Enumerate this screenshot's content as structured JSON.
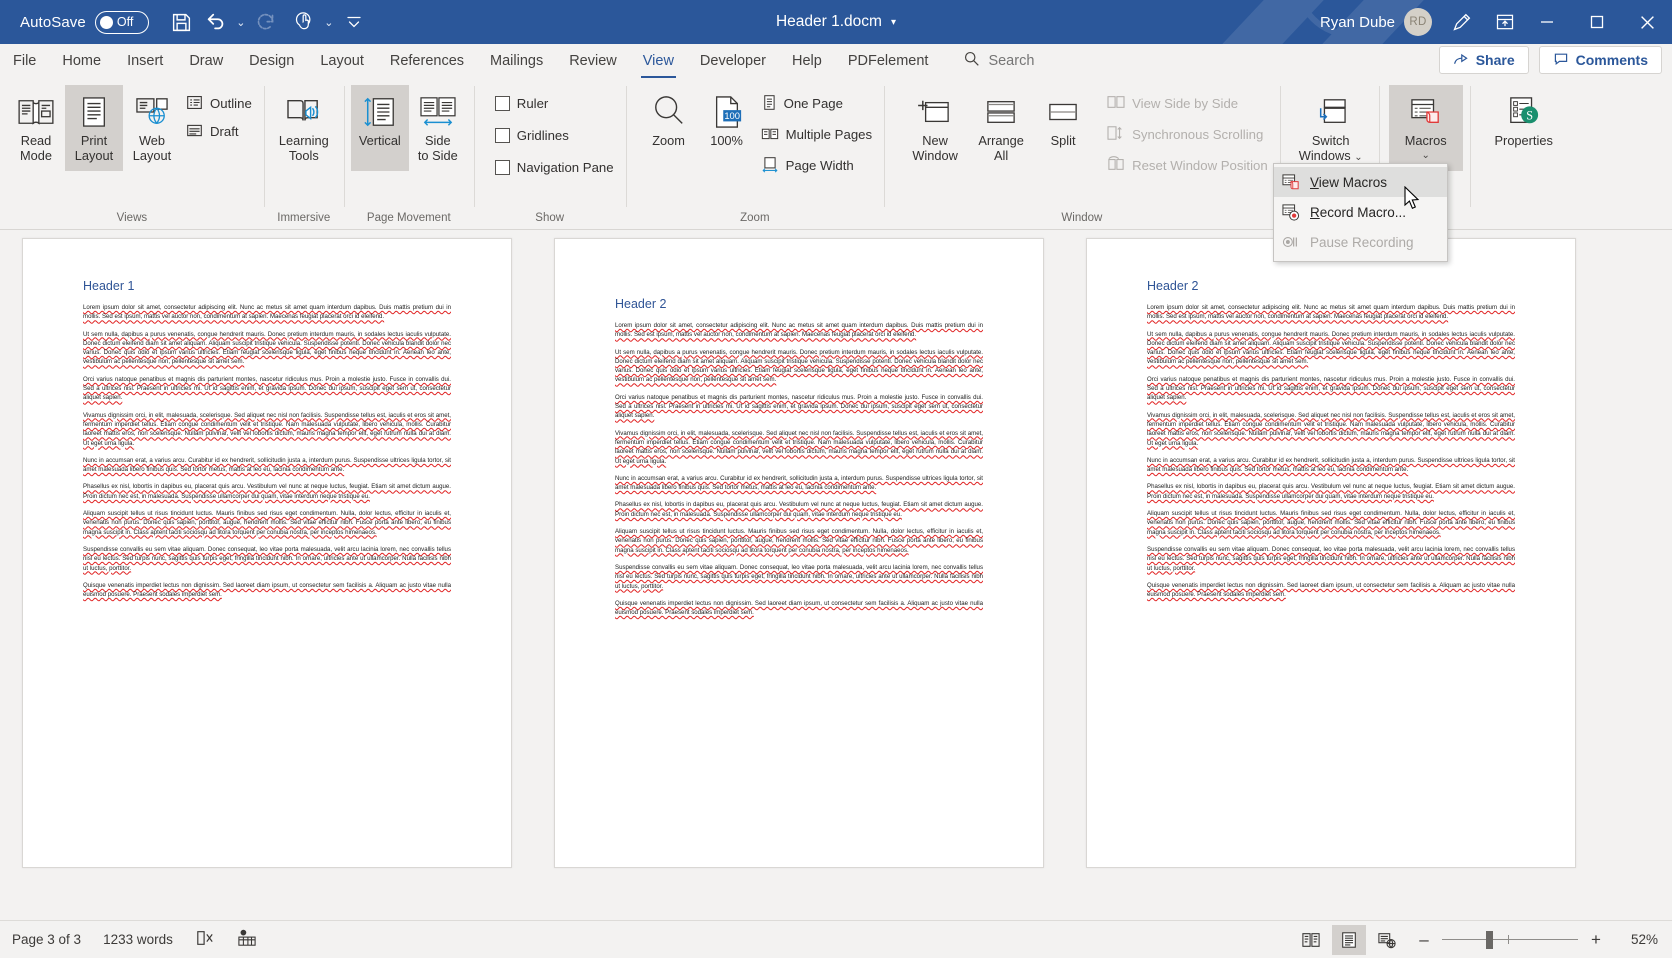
{
  "titlebar": {
    "autosave_label": "AutoSave",
    "autosave_state": "Off",
    "save_icon": "save-icon",
    "undo_icon": "undo-icon",
    "redo_icon": "redo-icon",
    "touch_icon": "touch-mode-icon",
    "customize_icon": "customize-quick-access-icon",
    "document_title": "Header 1.docm",
    "title_caret": "▾",
    "user_name": "Ryan Dube",
    "user_initials": "RD",
    "ink_icon": "pen-ink-icon",
    "ribbon_display_icon": "ribbon-display-options-icon",
    "minimize": "—",
    "maximize": "☐",
    "close": "✕",
    "accent_color": "#2b579a"
  },
  "tabs": [
    {
      "label": "File",
      "active": false
    },
    {
      "label": "Home",
      "active": false
    },
    {
      "label": "Insert",
      "active": false
    },
    {
      "label": "Draw",
      "active": false
    },
    {
      "label": "Design",
      "active": false
    },
    {
      "label": "Layout",
      "active": false
    },
    {
      "label": "References",
      "active": false
    },
    {
      "label": "Mailings",
      "active": false
    },
    {
      "label": "Review",
      "active": false
    },
    {
      "label": "View",
      "active": true
    },
    {
      "label": "Developer",
      "active": false
    },
    {
      "label": "Help",
      "active": false
    },
    {
      "label": "PDFelement",
      "active": false
    }
  ],
  "search": {
    "placeholder": "Search",
    "value": "",
    "icon": "search-icon"
  },
  "share": {
    "label": "Share",
    "icon": "share-icon"
  },
  "comments": {
    "label": "Comments",
    "icon": "comment-icon"
  },
  "ribbon": {
    "groups": [
      {
        "name": "views",
        "label": "Views",
        "big_buttons": [
          {
            "name": "read-mode",
            "line1": "Read",
            "line2": "Mode",
            "icon": "read-mode-icon",
            "selected": false
          },
          {
            "name": "print-layout",
            "line1": "Print",
            "line2": "Layout",
            "icon": "print-layout-icon",
            "selected": true
          },
          {
            "name": "web-layout",
            "line1": "Web",
            "line2": "Layout",
            "icon": "web-layout-icon",
            "selected": false
          }
        ],
        "small_buttons": [
          {
            "name": "outline",
            "label": "Outline",
            "icon": "outline-icon",
            "disabled": false
          },
          {
            "name": "draft",
            "label": "Draft",
            "icon": "draft-icon",
            "disabled": false
          }
        ]
      },
      {
        "name": "immersive",
        "label": "Immersive",
        "big_buttons": [
          {
            "name": "learning-tools",
            "line1": "Learning",
            "line2": "Tools",
            "icon": "learning-tools-icon",
            "selected": false
          }
        ],
        "small_buttons": []
      },
      {
        "name": "page-movement",
        "label": "Page Movement",
        "big_buttons": [
          {
            "name": "vertical",
            "line1": "Vertical",
            "line2": "",
            "icon": "vertical-scroll-icon",
            "selected": true
          },
          {
            "name": "side-to-side",
            "line1": "Side",
            "line2": "to Side",
            "icon": "side-to-side-icon",
            "selected": false
          }
        ],
        "small_buttons": []
      },
      {
        "name": "show",
        "label": "Show",
        "big_buttons": [],
        "small_buttons": [
          {
            "name": "ruler",
            "label": "Ruler",
            "icon": "checkbox-icon",
            "checked": false
          },
          {
            "name": "gridlines",
            "label": "Gridlines",
            "icon": "checkbox-icon",
            "checked": false
          },
          {
            "name": "navigation-pane",
            "label": "Navigation Pane",
            "icon": "checkbox-icon",
            "checked": false
          }
        ]
      },
      {
        "name": "zoom",
        "label": "Zoom",
        "big_buttons": [
          {
            "name": "zoom",
            "line1": "Zoom",
            "line2": "",
            "icon": "magnifier-icon",
            "selected": false
          },
          {
            "name": "zoom-100",
            "line1": "100%",
            "line2": "",
            "icon": "zoom-100-icon",
            "selected": false
          }
        ],
        "small_buttons": [
          {
            "name": "one-page",
            "label": "One Page",
            "icon": "one-page-icon",
            "disabled": false
          },
          {
            "name": "multiple-pages",
            "label": "Multiple Pages",
            "icon": "multiple-pages-icon",
            "disabled": false
          },
          {
            "name": "page-width",
            "label": "Page Width",
            "icon": "page-width-icon",
            "disabled": false
          }
        ]
      },
      {
        "name": "window",
        "label": "Window",
        "big_buttons": [
          {
            "name": "new-window",
            "line1": "New",
            "line2": "Window",
            "icon": "new-window-icon",
            "selected": false
          },
          {
            "name": "arrange-all",
            "line1": "Arrange",
            "line2": "All",
            "icon": "arrange-all-icon",
            "selected": false
          },
          {
            "name": "split",
            "line1": "Split",
            "line2": "",
            "icon": "split-icon",
            "selected": false
          }
        ],
        "small_buttons": [
          {
            "name": "view-side-by-side",
            "label": "View Side by Side",
            "icon": "side-by-side-icon",
            "disabled": true
          },
          {
            "name": "synchronous-scrolling",
            "label": "Synchronous Scrolling",
            "icon": "sync-scroll-icon",
            "disabled": true
          },
          {
            "name": "reset-window-position",
            "label": "Reset Window Position",
            "icon": "reset-window-icon",
            "disabled": true
          }
        ]
      },
      {
        "name": "switch-windows-group",
        "label": "",
        "big_buttons": [
          {
            "name": "switch-windows",
            "line1": "Switch",
            "line2": "Windows",
            "icon": "switch-windows-icon",
            "selected": false,
            "caret": "⌄"
          }
        ],
        "small_buttons": []
      },
      {
        "name": "macros-group",
        "label": "",
        "big_buttons": [
          {
            "name": "macros",
            "line1": "Macros",
            "line2": "",
            "icon": "macros-icon",
            "selected": true,
            "caret": "⌄"
          }
        ],
        "small_buttons": []
      },
      {
        "name": "properties-group",
        "label": "",
        "big_buttons": [
          {
            "name": "properties",
            "line1": "Properties",
            "line2": "",
            "icon": "sharepoint-properties-icon",
            "selected": false
          }
        ],
        "small_buttons": []
      }
    ]
  },
  "macros_menu": {
    "items": [
      {
        "name": "view-macros",
        "mnemonic": "V",
        "rest": "iew Macros",
        "icon": "view-macros-icon",
        "hover": true,
        "disabled": false
      },
      {
        "name": "record-macro",
        "mnemonic": "R",
        "rest": "ecord Macro...",
        "icon": "record-macro-icon",
        "hover": false,
        "disabled": false
      },
      {
        "name": "pause-recording",
        "mnemonic": "",
        "rest": "Pause Recording",
        "icon": "pause-recording-icon",
        "hover": false,
        "disabled": true
      }
    ]
  },
  "document": {
    "pages": [
      {
        "name": "page-1",
        "heading": "Header 1",
        "shifted": false,
        "paragraphs": [
          "Lorem ipsum dolor sit amet, consectetur adipiscing elit. Nunc ac metus sit amet quam interdum dapibus. Duis mattis pretium dui in mollis. Sed est ipsum, mattis vel auctor non, condimentum at sapien. Maecenas feugiat placerat orci id eleifend.",
          "Ut sem nulla, dapibus a purus venenatis, congue hendrerit mauris. Donec pretium interdum mauris, in sodales lectus iaculis vulputate. Donec dictum eleifend diam sit amet aliquam. Aliquam suscipit tristique vehicula. Suspendisse potenti. Donec vehicula blandit dolor nec varius. Donec quis odio et ipsum varius ultricies. Etiam feugiat scelerisque ligula, eget finibus neque tincidunt in. Aenean leo ante, vestibulum ac pellentesque non, pellentesque sit amet sem.",
          "Orci varius natoque penatibus et magnis dis parturient montes, nascetur ridiculus mus. Proin a molestie justo. Fusce in convallis dui. Sed a ultrices nisl. Praesent in ultricies mi. Ut id sagittis enim, et gravida ipsum. Donec dui ipsum, suscipit eget sem ut, consectetur aliquet sapien.",
          "Vivamus dignissim orci, in elit, malesuada, scelerisque. Sed aliquet nec nisl non facilisis. Suspendisse tellus est, iaculis et eros sit amet, fermentum imperdiet tellus. Etiam congue condimentum velit et tristique. Nam malesuada vulputate, libero vehicula, mollis. Curabitur laoreet mattis eros, non scelerisque. Nullam pulvinar, velit vel lobortis dictum, mauris magna tempor elit, eget rutrum nulla dui at diam. Ut eget urna ligula.",
          "Nunc in accumsan erat, a varius arcu. Curabitur id ex hendrerit, sollicitudin justa a, interdum purus. Suspendisse ultrices ligula tortor, sit amet malesuada libero finibus quis. Sed tortor metus, mattis at leo eu, lacinia condimentum ante.",
          "Phasellus ex nisl, lobortis in dapibus eu, placerat quis arcu. Vestibulum vel nunc at neque luctus, feugiat. Etiam sit amet dictum augue. Proin dictum nec est, in malesuada. Suspendisse ullamcorper dui quam, vitae interdum neque tristique eu.",
          "Aliquam suscipit tellus ut risus tincidunt luctus. Mauris finibus sed risus eget condimentum. Nulla, dolor lectus, efficitur in iaculis et, venenatis non purus. Donec quis sapien, porttitor, augue, hendrerit mollis. Sed vitae efficitur nibh. Fusce porta ante libero, eu finibus magna suscipit in. Class aptent taciti sociosqu ad litora torquent per conubia nostra, per inceptos himenaeos.",
          "Suspendisse convallis eu sem vitae aliquam. Donec consequat, leo vitae porta malesuada, velit arcu lacinia lorem, nec convallis tellus nisl eu lectus. Sed turpis nunc, sagittis quis turpis eget, fringilla tincidunt nibh. In ornare, ultricies ante ut ullamcorper. Nulla facilisis nibh ut luctus, porttitor.",
          "Quisque venenatis imperdiet lectus non dignissim. Sed laoreet diam ipsum, ut consectetur sem facilisis a. Aliquam ac justo vitae nulla euismod posuere. Praesent sodales imperdiet sem."
        ]
      },
      {
        "name": "page-2",
        "heading": "Header 2",
        "shifted": true,
        "paragraphs": [
          "Lorem ipsum dolor sit amet, consectetur adipiscing elit. Nunc ac metus sit amet quam interdum dapibus. Duis mattis pretium dui in mollis. Sed est ipsum, mattis vel auctor non, condimentum at sapien. Maecenas feugiat placerat orci id eleifend.",
          "Ut sem nulla, dapibus a purus venenatis, congue hendrerit mauris. Donec pretium interdum mauris, in sodales lectus iaculis vulputate. Donec dictum eleifend diam sit amet aliquam. Aliquam suscipit tristique vehicula. Suspendisse potenti. Donec vehicula blandit dolor nec varius. Donec quis odio et ipsum varius ultricies. Etiam feugiat scelerisque ligula, eget finibus neque tincidunt in. Aenean leo ante, vestibulum ac pellentesque non, pellentesque sit amet sem.",
          "Orci varius natoque penatibus et magnis dis parturient montes, nascetur ridiculus mus. Proin a molestie justo. Fusce in convallis dui. Sed a ultrices nisl. Praesent in ultricies mi. Ut id sagittis enim, et gravida ipsum. Donec dui ipsum, suscipit eget sem ut, consectetur aliquet sapien.",
          "Vivamus dignissim orci, in elit, malesuada, scelerisque. Sed aliquet nec nisl non facilisis. Suspendisse tellus est, iaculis et eros sit amet, fermentum imperdiet tellus. Etiam congue condimentum velit et tristique. Nam malesuada vulputate, libero vehicula, mollis. Curabitur laoreet mattis eros, non scelerisque. Nullam pulvinar, velit vel lobortis dictum, mauris magna tempor elit, eget rutrum nulla dui at diam. Ut eget urna ligula.",
          "Nunc in accumsan erat, a varius arcu. Curabitur id ex hendrerit, sollicitudin justa a, interdum purus. Suspendisse ultrices ligula tortor, sit amet malesuada libero finibus quis. Sed tortor metus, mattis at leo eu, lacinia condimentum ante.",
          "Phasellus ex nisl, lobortis in dapibus eu, placerat quis arcu. Vestibulum vel nunc at neque luctus, feugiat. Etiam sit amet dictum augue. Proin dictum nec est, in malesuada. Suspendisse ullamcorper dui quam, vitae interdum neque tristique eu.",
          "Aliquam suscipit tellus ut risus tincidunt luctus. Mauris finibus sed risus eget condimentum. Nulla, dolor lectus, efficitur in iaculis et, venenatis non purus. Donec quis sapien, porttitor, augue, hendrerit mollis. Sed vitae efficitur nibh. Fusce porta ante libero, eu finibus magna suscipit in. Class aptent taciti sociosqu ad litora torquent per conubia nostra, per inceptos himenaeos.",
          "Suspendisse convallis eu sem vitae aliquam. Donec consequat, leo vitae porta malesuada, velit arcu lacinia lorem, nec convallis tellus nisl eu lectus. Sed turpis nunc, sagittis quis turpis eget, fringilla tincidunt nibh. In ornare, ultricies ante ut ullamcorper. Nulla facilisis nibh ut luctus, porttitor.",
          "Quisque venenatis imperdiet lectus non dignissim. Sed laoreet diam ipsum, ut consectetur sem facilisis a. Aliquam ac justo vitae nulla euismod posuere. Praesent sodales imperdiet sem."
        ]
      },
      {
        "name": "page-3",
        "heading": "Header 2",
        "shifted": false,
        "paragraphs": [
          "Lorem ipsum dolor sit amet, consectetur adipiscing elit. Nunc ac metus sit amet quam interdum dapibus. Duis mattis pretium dui in mollis. Sed est ipsum, mattis vel auctor non, condimentum at sapien. Maecenas feugiat placerat orci id eleifend.",
          "Ut sem nulla, dapibus a purus venenatis, congue hendrerit mauris. Donec pretium interdum mauris, in sodales lectus iaculis vulputate. Donec dictum eleifend diam sit amet aliquam. Aliquam suscipit tristique vehicula. Suspendisse potenti. Donec vehicula blandit dolor nec varius. Donec quis odio et ipsum varius ultricies. Etiam feugiat scelerisque ligula, eget finibus neque tincidunt in. Aenean leo ante, vestibulum ac pellentesque non, pellentesque sit amet sem.",
          "Orci varius natoque penatibus et magnis dis parturient montes, nascetur ridiculus mus. Proin a molestie justo. Fusce in convallis dui. Sed a ultrices nisl. Praesent in ultricies mi. Ut id sagittis enim, et gravida ipsum. Donec dui ipsum, suscipit eget sem ut, consectetur aliquet sapien.",
          "Vivamus dignissim orci, in elit, malesuada, scelerisque. Sed aliquet nec nisl non facilisis. Suspendisse tellus est, iaculis et eros sit amet, fermentum imperdiet tellus. Etiam congue condimentum velit et tristique. Nam malesuada vulputate, libero vehicula, mollis. Curabitur laoreet mattis eros, non scelerisque. Nullam pulvinar, velit vel lobortis dictum, mauris magna tempor elit, eget rutrum nulla dui at diam. Ut eget urna ligula.",
          "Nunc in accumsan erat, a varius arcu. Curabitur id ex hendrerit, sollicitudin justa a, interdum purus. Suspendisse ultrices ligula tortor, sit amet malesuada libero finibus quis. Sed tortor metus, mattis at leo eu, lacinia condimentum ante.",
          "Phasellus ex nisl, lobortis in dapibus eu, placerat quis arcu. Vestibulum vel nunc at neque luctus, feugiat. Etiam sit amet dictum augue. Proin dictum nec est, in malesuada. Suspendisse ullamcorper dui quam, vitae interdum neque tristique eu.",
          "Aliquam suscipit tellus ut risus tincidunt luctus. Mauris finibus sed risus eget condimentum. Nulla, dolor lectus, efficitur in iaculis et, venenatis non purus. Donec quis sapien, porttitor, augue, hendrerit mollis. Sed vitae efficitur nibh. Fusce porta ante libero, eu finibus magna suscipit in. Class aptent taciti sociosqu ad litora torquent per conubia nostra, per inceptos himenaeos.",
          "Suspendisse convallis eu sem vitae aliquam. Donec consequat, leo vitae porta malesuada, velit arcu lacinia lorem, nec convallis tellus nisl eu lectus. Sed turpis nunc, sagittis quis turpis eget, fringilla tincidunt nibh. In ornare, ultricies ante ut ullamcorper. Nulla facilisis nibh ut luctus, porttitor.",
          "Quisque venenatis imperdiet lectus non dignissim. Sed laoreet diam ipsum, ut consectetur sem facilisis a. Aliquam ac justo vitae nulla euismod posuere. Praesent sodales imperdiet sem."
        ]
      }
    ]
  },
  "statusbar": {
    "page_indicator": "Page 3 of 3",
    "word_count": "1233 words",
    "proofing_icon": "proofing-errors-icon",
    "accessibility_icon": "accessibility-checker-icon",
    "view_buttons": [
      {
        "name": "read-mode-view",
        "icon": "read-mode-view-icon",
        "selected": false
      },
      {
        "name": "print-layout-view",
        "icon": "print-layout-view-icon",
        "selected": true
      },
      {
        "name": "web-layout-view",
        "icon": "web-layout-view-icon",
        "selected": false
      }
    ],
    "zoom_out": "–",
    "zoom_in": "+",
    "zoom_level": "52%"
  }
}
